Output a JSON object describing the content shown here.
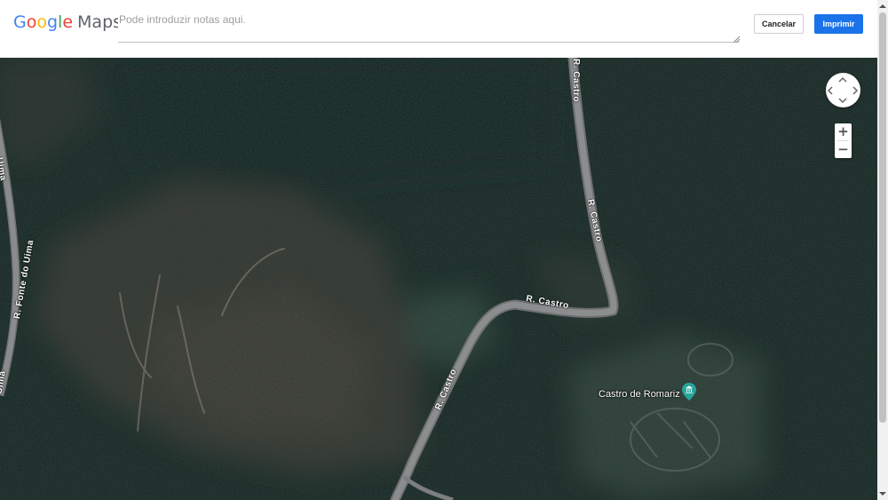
{
  "header": {
    "logo_text": "Google",
    "logo_suffix": "Maps",
    "notes_placeholder": "Pode introduzir notas aqui.",
    "cancel_label": "Cancelar",
    "print_label": "Imprimir",
    "colors": {
      "print_button": "#1a73e8",
      "logo_blue": "#4285f4",
      "logo_red": "#ea4335",
      "logo_yellow": "#fbbc05",
      "logo_green": "#34a853"
    }
  },
  "map": {
    "view": "satellite",
    "road_labels": {
      "castro_top": "R. Castro",
      "castro_right": "R. Castro",
      "castro_middle": "R. Castro",
      "castro_lower": "R. Castro",
      "fonte_do_uima": "R. Fonte do Uima",
      "uima_top": "Uima",
      "uima_bottom": "Uima"
    },
    "poi": {
      "name": "Castro de Romariz",
      "icon": "museum-pin-icon",
      "color": "#26a69a"
    },
    "controls": {
      "navigation_icon": "pan-navigation-icon",
      "zoom_in": "+",
      "zoom_out": "−"
    }
  }
}
